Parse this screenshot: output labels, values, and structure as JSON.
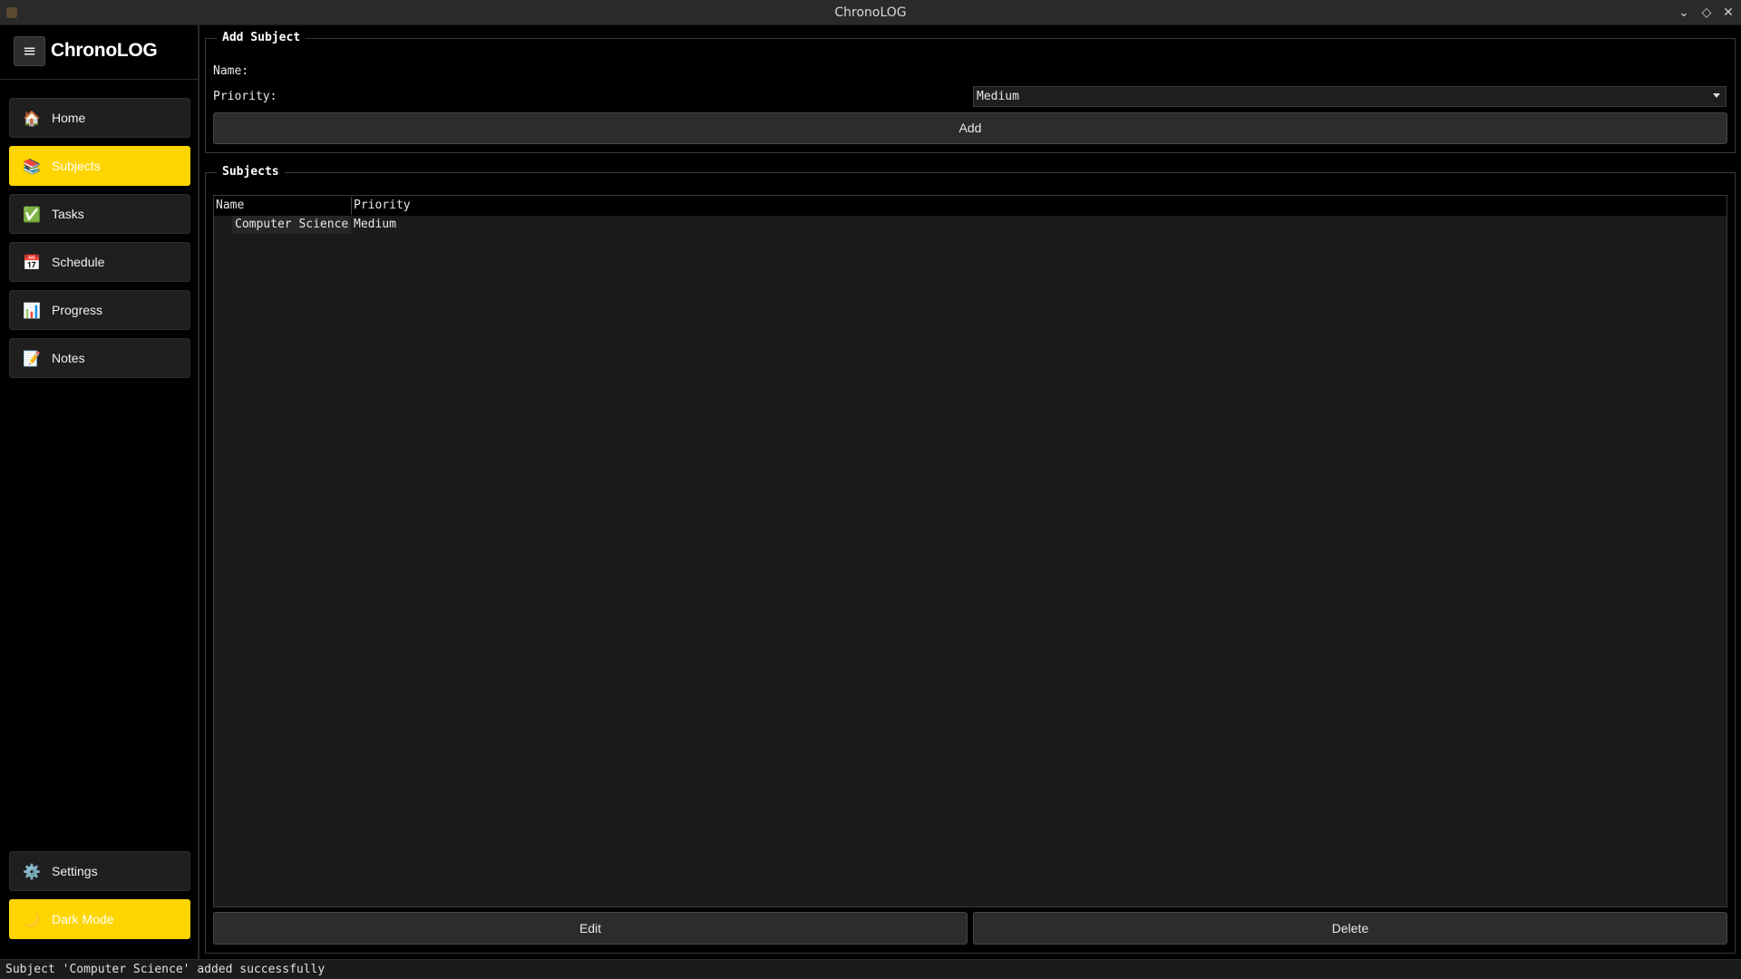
{
  "window": {
    "title": "ChronoLOG"
  },
  "sidebar": {
    "brand": "ChronoLOG",
    "items": [
      {
        "label": "Home",
        "icon": "🏠"
      },
      {
        "label": "Subjects",
        "icon": "📚"
      },
      {
        "label": "Tasks",
        "icon": "✅"
      },
      {
        "label": "Schedule",
        "icon": "📅"
      },
      {
        "label": "Progress",
        "icon": "📊"
      },
      {
        "label": "Notes",
        "icon": "📝"
      }
    ],
    "settings": {
      "label": "Settings",
      "icon": "⚙️"
    },
    "dark_mode": {
      "label": "Dark Mode",
      "icon": "🌙"
    },
    "accent_color": "#ffd500"
  },
  "add_subject": {
    "title": "Add Subject",
    "name_label": "Name:",
    "name_value": "",
    "priority_label": "Priority:",
    "priority_value": "Medium",
    "add_button": "Add"
  },
  "subjects": {
    "title": "Subjects",
    "columns": [
      "Name",
      "Priority"
    ],
    "rows": [
      {
        "name": "Computer Science",
        "priority": "Medium"
      }
    ],
    "edit_button": "Edit",
    "delete_button": "Delete"
  },
  "status": {
    "message": "Subject 'Computer Science' added successfully"
  }
}
